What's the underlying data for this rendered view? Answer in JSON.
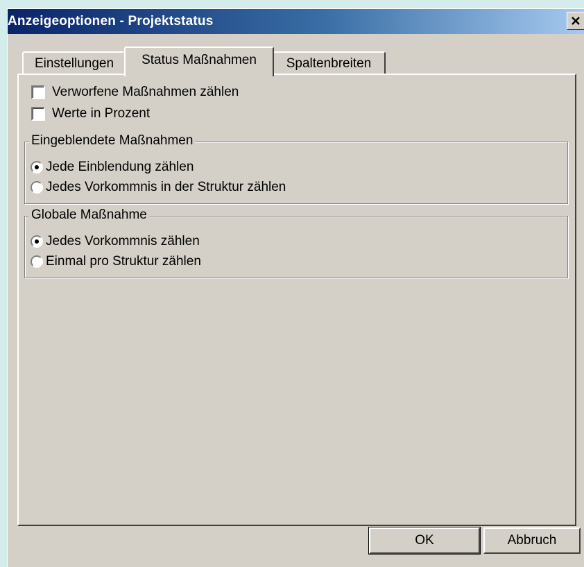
{
  "window": {
    "title": "Anzeigeoptionen - Projektstatus",
    "close_icon": "close-icon"
  },
  "tabs": [
    {
      "label": "Einstellungen",
      "active": false
    },
    {
      "label": "Status Maßnahmen",
      "active": true
    },
    {
      "label": "Spaltenbreiten",
      "active": false
    }
  ],
  "checkboxes": [
    {
      "label": "Verworfene Maßnahmen zählen",
      "checked": false
    },
    {
      "label": "Werte in Prozent",
      "checked": false
    }
  ],
  "group_eingeblendet": {
    "title": "Eingeblendete Maßnahmen",
    "options": [
      {
        "label": "Jede Einblendung zählen",
        "selected": true
      },
      {
        "label": "Jedes Vorkommnis in der Struktur zählen",
        "selected": false
      }
    ]
  },
  "group_global": {
    "title": "Globale Maßnahme",
    "options": [
      {
        "label": "Jedes Vorkommnis zählen",
        "selected": true
      },
      {
        "label": "Einmal pro Struktur zählen",
        "selected": false
      }
    ]
  },
  "buttons": {
    "ok": "OK",
    "cancel": "Abbruch"
  },
  "colors": {
    "dialog_face": "#d4d0c8",
    "title_gradient_start": "#0a246a",
    "title_gradient_end": "#a6caf0",
    "desktop": "#d4ecec"
  }
}
